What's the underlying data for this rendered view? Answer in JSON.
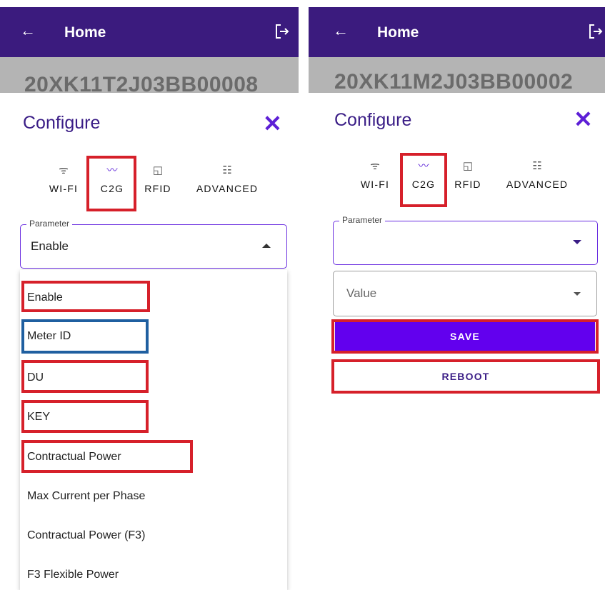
{
  "left": {
    "appbar_title": "Home",
    "back_icon": "arrow-left-icon",
    "logout_icon": "logout-icon",
    "serial": "20XK11T2J03BB00008",
    "configure_title": "Configure",
    "close_label": "✕",
    "tabs": [
      {
        "icon": "wifi-icon",
        "glyph": "ᯤ",
        "label": "WI-FI"
      },
      {
        "icon": "trend-line-icon",
        "glyph": "〰",
        "label": "C2G"
      },
      {
        "icon": "rfid-card-icon",
        "glyph": "◱",
        "label": "RFID"
      },
      {
        "icon": "sliders-icon",
        "glyph": "☷",
        "label": "ADVANCED"
      }
    ],
    "parameter_legend": "Parameter",
    "parameter_value": "Enable",
    "options": [
      "Enable",
      "Meter ID",
      "DU",
      "KEY",
      "Contractual Power",
      "Max Current per Phase",
      "Contractual Power (F3)",
      "F3 Flexible Power"
    ]
  },
  "right": {
    "appbar_title": "Home",
    "serial": "20XK11M2J03BB00002",
    "configure_title": "Configure",
    "close_label": "✕",
    "tabs": [
      {
        "label": "WI-FI"
      },
      {
        "label": "C2G"
      },
      {
        "label": "RFID"
      },
      {
        "label": "ADVANCED"
      }
    ],
    "parameter_legend": "Parameter",
    "value_placeholder": "Value",
    "save_label": "SAVE",
    "reboot_label": "REBOOT"
  },
  "colors": {
    "appbar": "#3b1b7e",
    "accent": "#6200ee",
    "highlight_red": "#d6202a",
    "highlight_blue": "#1f5fa0"
  }
}
